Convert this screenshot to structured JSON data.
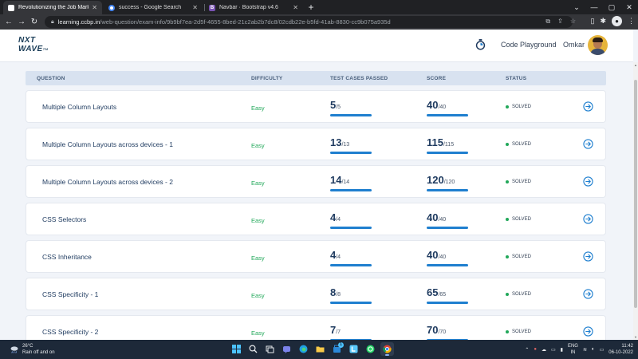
{
  "browser": {
    "tabs": [
      {
        "title": "Revolutionizing the Job Market |",
        "active": true,
        "favicon_color": "#ffffff"
      },
      {
        "title": "success - Google Search",
        "active": false,
        "favicon_color": "#4285f4"
      },
      {
        "title": "Navbar · Bootstrap v4.6",
        "active": false,
        "favicon_color": "#7952b3",
        "favicon_letter": "B"
      }
    ],
    "new_tab_symbol": "+",
    "url_host": "learning.ccbp.in",
    "url_path": "/web-question/exam-info/9b9bf7ea-2d5f-4655-8bed-21c2ab2b7dc8/02cdb22e-b5fd-41ab-8830-cc9b075a935d"
  },
  "header": {
    "logo_line1": "NXT",
    "logo_line2": "WAVE",
    "logo_tm": "TM",
    "code_playground_label": "Code Playground",
    "user_name": "Omkar"
  },
  "table": {
    "columns": [
      "QUESTION",
      "DIFFICULTY",
      "TEST CASES PASSED",
      "SCORE",
      "STATUS"
    ],
    "rows": [
      {
        "question": "Multiple Column Layouts",
        "difficulty": "Easy",
        "passed": "5",
        "passed_total": "/5",
        "score": "40",
        "score_total": "/40",
        "status": "SOLVED"
      },
      {
        "question": "Multiple Column Layouts across devices - 1",
        "difficulty": "Easy",
        "passed": "13",
        "passed_total": "/13",
        "score": "115",
        "score_total": "/115",
        "status": "SOLVED"
      },
      {
        "question": "Multiple Column Layouts across devices - 2",
        "difficulty": "Easy",
        "passed": "14",
        "passed_total": "/14",
        "score": "120",
        "score_total": "/120",
        "status": "SOLVED"
      },
      {
        "question": "CSS Selectors",
        "difficulty": "Easy",
        "passed": "4",
        "passed_total": "/4",
        "score": "40",
        "score_total": "/40",
        "status": "SOLVED"
      },
      {
        "question": "CSS Inheritance",
        "difficulty": "Easy",
        "passed": "4",
        "passed_total": "/4",
        "score": "40",
        "score_total": "/40",
        "status": "SOLVED"
      },
      {
        "question": "CSS Specificity - 1",
        "difficulty": "Easy",
        "passed": "8",
        "passed_total": "/8",
        "score": "65",
        "score_total": "/65",
        "status": "SOLVED"
      },
      {
        "question": "CSS Specificity - 2",
        "difficulty": "Easy",
        "passed": "7",
        "passed_total": "/7",
        "score": "70",
        "score_total": "/70",
        "status": "SOLVED"
      }
    ]
  },
  "colors": {
    "easy": "#22a85a",
    "progress": "#1f7fcf",
    "solved_dot": "#22a85a",
    "header_row": "#d8e2f0"
  },
  "taskbar": {
    "temperature": "26°C",
    "weather_text": "Rain off and on",
    "language_line1": "ENG",
    "language_line2": "IN",
    "time": "11:42",
    "date": "06-10-2022",
    "notification_count": "1"
  }
}
